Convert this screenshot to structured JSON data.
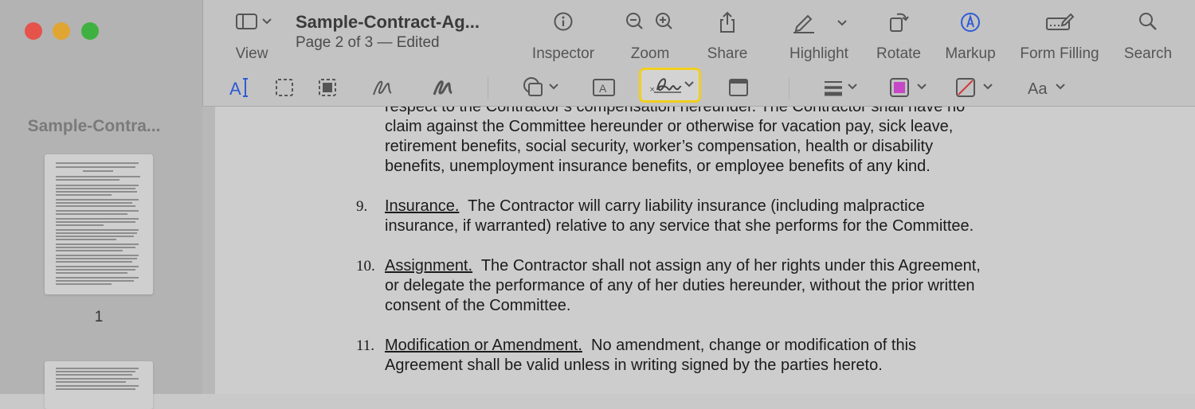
{
  "window": {
    "traffic_lights": [
      {
        "name": "close",
        "color": "#e5534b"
      },
      {
        "name": "minimize",
        "color": "#e0a631"
      },
      {
        "name": "zoom",
        "color": "#3fb141"
      }
    ]
  },
  "sidebar": {
    "title": "Sample-Contra...",
    "pages": [
      {
        "number": "1"
      }
    ]
  },
  "document_header": {
    "title": "Sample-Contract-Ag...",
    "subtitle": "Page 2 of 3 — Edited"
  },
  "toolbar": {
    "view": {
      "label": "View",
      "icon": "sidebar-icon"
    },
    "inspector": {
      "label": "Inspector",
      "icon": "info-icon"
    },
    "zoom": {
      "label": "Zoom",
      "icons": [
        "zoom-out-icon",
        "zoom-in-icon"
      ]
    },
    "share": {
      "label": "Share",
      "icon": "share-icon"
    },
    "highlight": {
      "label": "Highlight",
      "icon": "pencil-icon"
    },
    "rotate": {
      "label": "Rotate",
      "icon": "rotate-icon"
    },
    "markup": {
      "label": "Markup",
      "icon": "markup-pen-icon",
      "color": "#2f5bd6"
    },
    "form_filling": {
      "label": "Form Filling",
      "icon": "form-filling-icon"
    },
    "search": {
      "label": "Search",
      "icon": "search-icon"
    }
  },
  "markup_toolbar": {
    "tools": [
      {
        "name": "text-selection",
        "icon": "text-cursor-icon",
        "glyph": "A",
        "active": true,
        "color": "#2f5bd6"
      },
      {
        "name": "rectangular-selection",
        "icon": "rect-selection-icon"
      },
      {
        "name": "redact",
        "icon": "redact-icon"
      },
      {
        "name": "sketch",
        "icon": "sketch-icon"
      },
      {
        "name": "draw",
        "icon": "draw-icon"
      },
      {
        "name": "shapes",
        "icon": "shapes-icon"
      },
      {
        "name": "text-box",
        "icon": "text-box-icon",
        "glyph": "A"
      },
      {
        "name": "sign",
        "icon": "signature-icon",
        "highlighted": true,
        "highlight_color": "#f2cf1d"
      },
      {
        "name": "note",
        "icon": "note-icon"
      },
      {
        "name": "shape-style",
        "icon": "line-style-icon"
      },
      {
        "name": "border-color",
        "icon": "border-color-icon",
        "color": "#c648c6"
      },
      {
        "name": "fill-color",
        "icon": "fill-color-icon",
        "color": "#d23b3b"
      },
      {
        "name": "text-style",
        "icon": "text-style-icon",
        "glyph": "Aa"
      }
    ]
  },
  "document": {
    "lines": [
      {
        "text": "respect to the Contractor’s compensation hereunder.  The Contractor shall have no"
      },
      {
        "text": "claim against the Committee hereunder or otherwise for vacation pay, sick leave,"
      },
      {
        "text": "retirement benefits, social security, worker’s compensation, health or disability"
      },
      {
        "text": "benefits, unemployment insurance benefits, or employee benefits of any kind."
      }
    ],
    "clauses": [
      {
        "number": "9.",
        "heading": "Insurance.",
        "first_line": "  The Contractor will carry liability insurance (including malpractice",
        "rest": [
          "insurance, if warranted) relative to any service that she performs for the Committee."
        ]
      },
      {
        "number": "10.",
        "heading": "Assignment.",
        "first_line": "  The Contractor shall not assign any of her rights under this Agreement,",
        "rest": [
          "or delegate the performance of any of her duties hereunder, without the prior written",
          "consent of the Committee."
        ]
      },
      {
        "number": "11.",
        "heading": "Modification or Amendment.",
        "first_line": "  No amendment, change or modification of this",
        "rest": [
          "Agreement shall be valid unless in writing signed by the parties hereto."
        ]
      }
    ]
  }
}
